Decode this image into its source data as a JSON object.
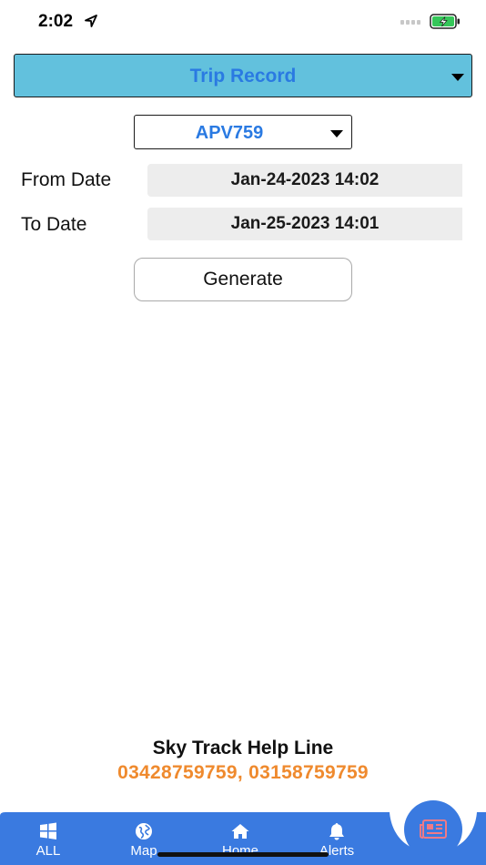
{
  "status_bar": {
    "time": "2:02"
  },
  "report_select": {
    "value": "Trip Record"
  },
  "vehicle_select": {
    "value": "APV759"
  },
  "from_date": {
    "label": "From Date",
    "value": "Jan-24-2023 14:02"
  },
  "to_date": {
    "label": "To Date",
    "value": "Jan-25-2023 14:01"
  },
  "generate_button": {
    "label": "Generate"
  },
  "help": {
    "title": "Sky Track Help Line",
    "numbers": "03428759759, 03158759759"
  },
  "bottom_nav": {
    "items": [
      {
        "label": "ALL",
        "icon": "windows-icon"
      },
      {
        "label": "Map",
        "icon": "globe-icon"
      },
      {
        "label": "Home",
        "icon": "home-icon"
      },
      {
        "label": "Alerts",
        "icon": "bell-icon"
      }
    ],
    "fab_icon": "newspaper-icon"
  },
  "colors": {
    "header_bg": "#62c1dd",
    "accent_blue": "#2a7ae2",
    "nav_blue": "#3a7ae0",
    "help_orange": "#ef8a2e"
  }
}
